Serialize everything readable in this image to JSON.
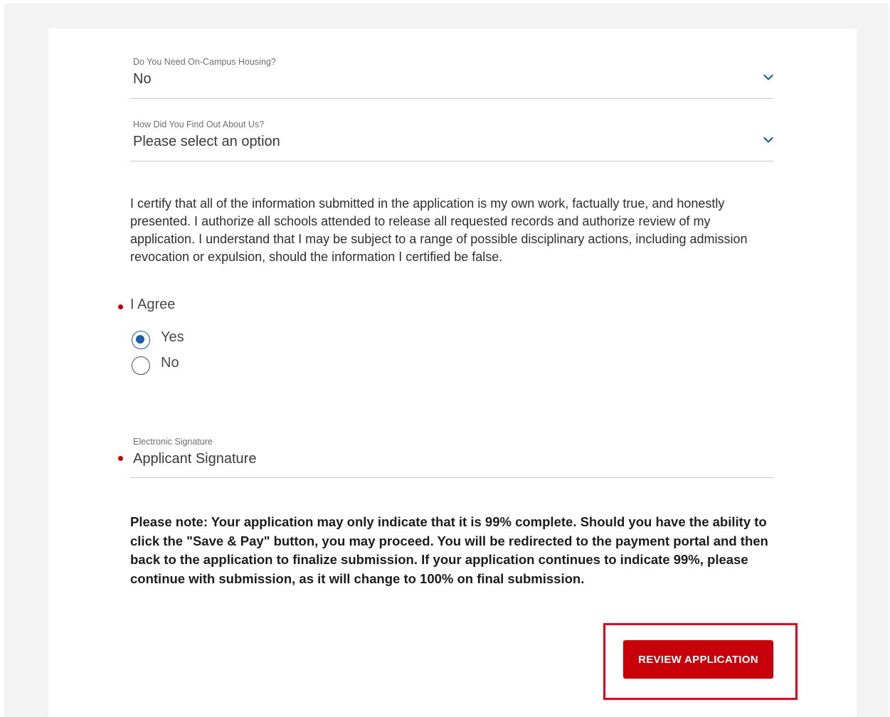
{
  "housing": {
    "label": "Do You Need On-Campus Housing?",
    "value": "No"
  },
  "referral": {
    "label": "How Did You Find Out About Us?",
    "placeholder": "Please select an option"
  },
  "certification": {
    "text": "I certify that all of the information submitted in the application is my own work, factually true, and honestly presented. I authorize all schools attended to release all requested records and authorize review of my application. I understand that I may be subject to a range of possible disciplinary actions, including admission revocation or expulsion, should the information I certified be false."
  },
  "agree": {
    "label": "I Agree",
    "options": [
      {
        "label": "Yes",
        "selected": true
      },
      {
        "label": "No",
        "selected": false
      }
    ]
  },
  "signature": {
    "label": "Electronic Signature",
    "placeholder": "Applicant Signature"
  },
  "note": {
    "text": "Please note: Your application may only indicate that it is 99% complete.  Should you have the ability to click the \"Save & Pay\" button, you may proceed.  You will be redirected to the payment portal and then back to the application to finalize submission.  If your application continues to indicate 99%, please continue with submission, as it will change to 100% on final submission."
  },
  "actions": {
    "review_label": "REVIEW APPLICATION"
  },
  "colors": {
    "accent_blue": "#1d5fa6",
    "button_red": "#c8000a",
    "required_red": "#c00000",
    "highlight_red": "#e2001a"
  },
  "icons": {
    "dropdown": "chevron-down-icon",
    "required": "required-dot-icon"
  }
}
